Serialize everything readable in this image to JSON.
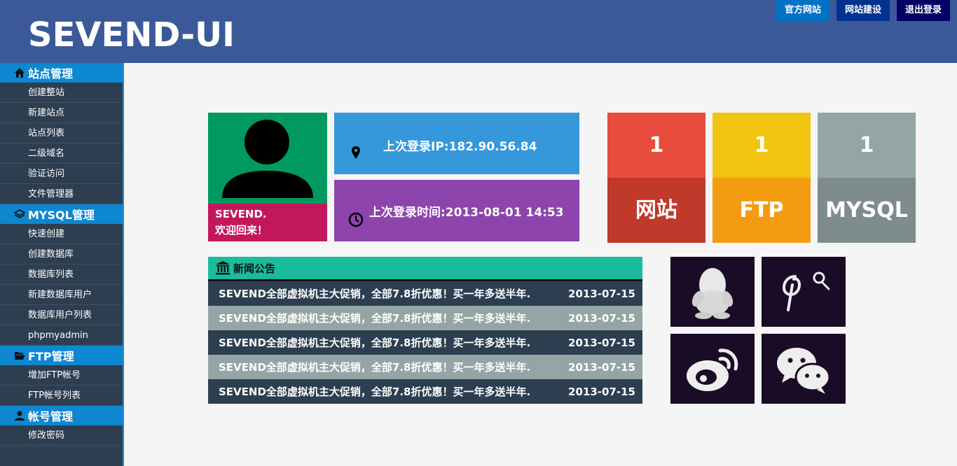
{
  "header": {
    "logo": "SEVEND-UI",
    "links": [
      "官方网站",
      "网站建设",
      "退出登录"
    ]
  },
  "sidebar": {
    "sections": [
      {
        "title": "站点管理",
        "icon": "home-icon",
        "items": [
          "创建整站",
          "新建站点",
          "站点列表",
          "二级域名",
          "验证访问",
          "文件管理器"
        ]
      },
      {
        "title": "MYSQL管理",
        "icon": "layers-icon",
        "items": [
          "快速创建",
          "创建数据库",
          "数据库列表",
          "新建数据库用户",
          "数据库用户列表",
          "phpmyadmin"
        ]
      },
      {
        "title": "FTP管理",
        "icon": "folder-open-icon",
        "items": [
          "增加FTP帐号",
          "FTP帐号列表"
        ]
      },
      {
        "title": "帐号管理",
        "icon": "user-icon",
        "items": [
          "修改密码"
        ]
      }
    ]
  },
  "profile": {
    "name": "SEVEND.",
    "welcome": "欢迎回来！",
    "last_ip": "上次登录IP:182.90.56.84",
    "last_time": "上次登录时间:2013-08-01 14:53"
  },
  "stats": [
    {
      "value": "1",
      "label": "网站"
    },
    {
      "value": "1",
      "label": "FTP"
    },
    {
      "value": "1",
      "label": "MYSQL"
    }
  ],
  "news": {
    "title": "新闻公告",
    "rows": [
      {
        "text": "SEVEND全部虚拟机主大促销，全部7.8折优惠！买一年多送半年.",
        "date": "2013-07-15"
      },
      {
        "text": "SEVEND全部虚拟机主大促销，全部7.8折优惠！买一年多送半年.",
        "date": "2013-07-15"
      },
      {
        "text": "SEVEND全部虚拟机主大促销，全部7.8折优惠！买一年多送半年.",
        "date": "2013-07-15"
      },
      {
        "text": "SEVEND全部虚拟机主大促销，全部7.8折优惠！买一年多送半年.",
        "date": "2013-07-15"
      },
      {
        "text": "SEVEND全部虚拟机主大促销，全部7.8折优惠！买一年多送半年.",
        "date": "2013-07-15"
      }
    ]
  },
  "social": [
    "qq-icon",
    "pinterest-icon",
    "weibo-icon",
    "wechat-icon"
  ],
  "colors": {
    "header": "#3b5998",
    "sidebar": "#2d3e50",
    "sidebar_head": "#0d87d0",
    "profile_green": "#009a61",
    "welcome_red": "#c2185b",
    "ip_blue": "#3498db",
    "time_purple": "#8e44ad",
    "stat_red": "#e74c3c",
    "stat_yellow": "#f1c40f",
    "stat_gray": "#95a5a6",
    "news_teal": "#1abc9c"
  }
}
